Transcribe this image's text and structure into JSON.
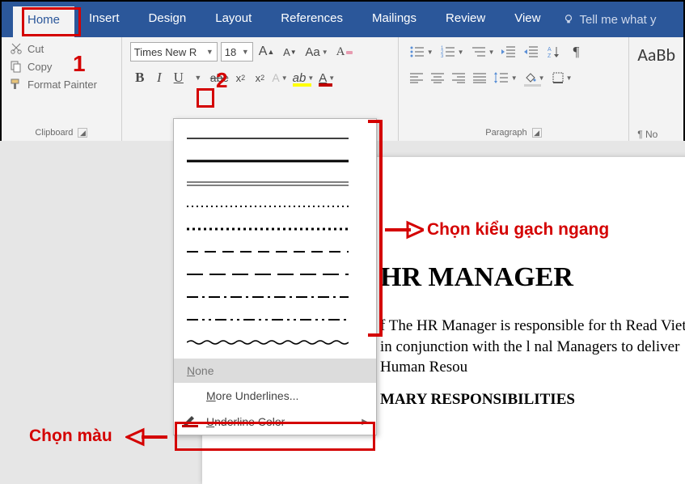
{
  "menubar": {
    "tabs": [
      "Home",
      "Insert",
      "Design",
      "Layout",
      "References",
      "Mailings",
      "Review",
      "View"
    ],
    "tellme": "Tell me what y"
  },
  "clipboard": {
    "cut": "Cut",
    "copy": "Copy",
    "format_painter": "Format Painter",
    "group_label": "Clipboard"
  },
  "font": {
    "name": "Times New R",
    "size": "18"
  },
  "paragraph": {
    "group_label": "Paragraph"
  },
  "styles": {
    "preview": "AaBb",
    "name": "¶ No"
  },
  "dropdown": {
    "none": "None",
    "more": "More Underlines...",
    "color": "Underline Color"
  },
  "document": {
    "title": "HR MANAGER",
    "p1": "f The HR Manager is responsible for th Read Vietnam in conjunction with the l nal Managers to deliver Human Resou",
    "h2": "MARY RESPONSIBILITIES"
  },
  "annotations": {
    "n1": "1",
    "n2": "2",
    "style_label": "Chọn kiểu gạch ngang",
    "color_label": "Chọn màu"
  }
}
